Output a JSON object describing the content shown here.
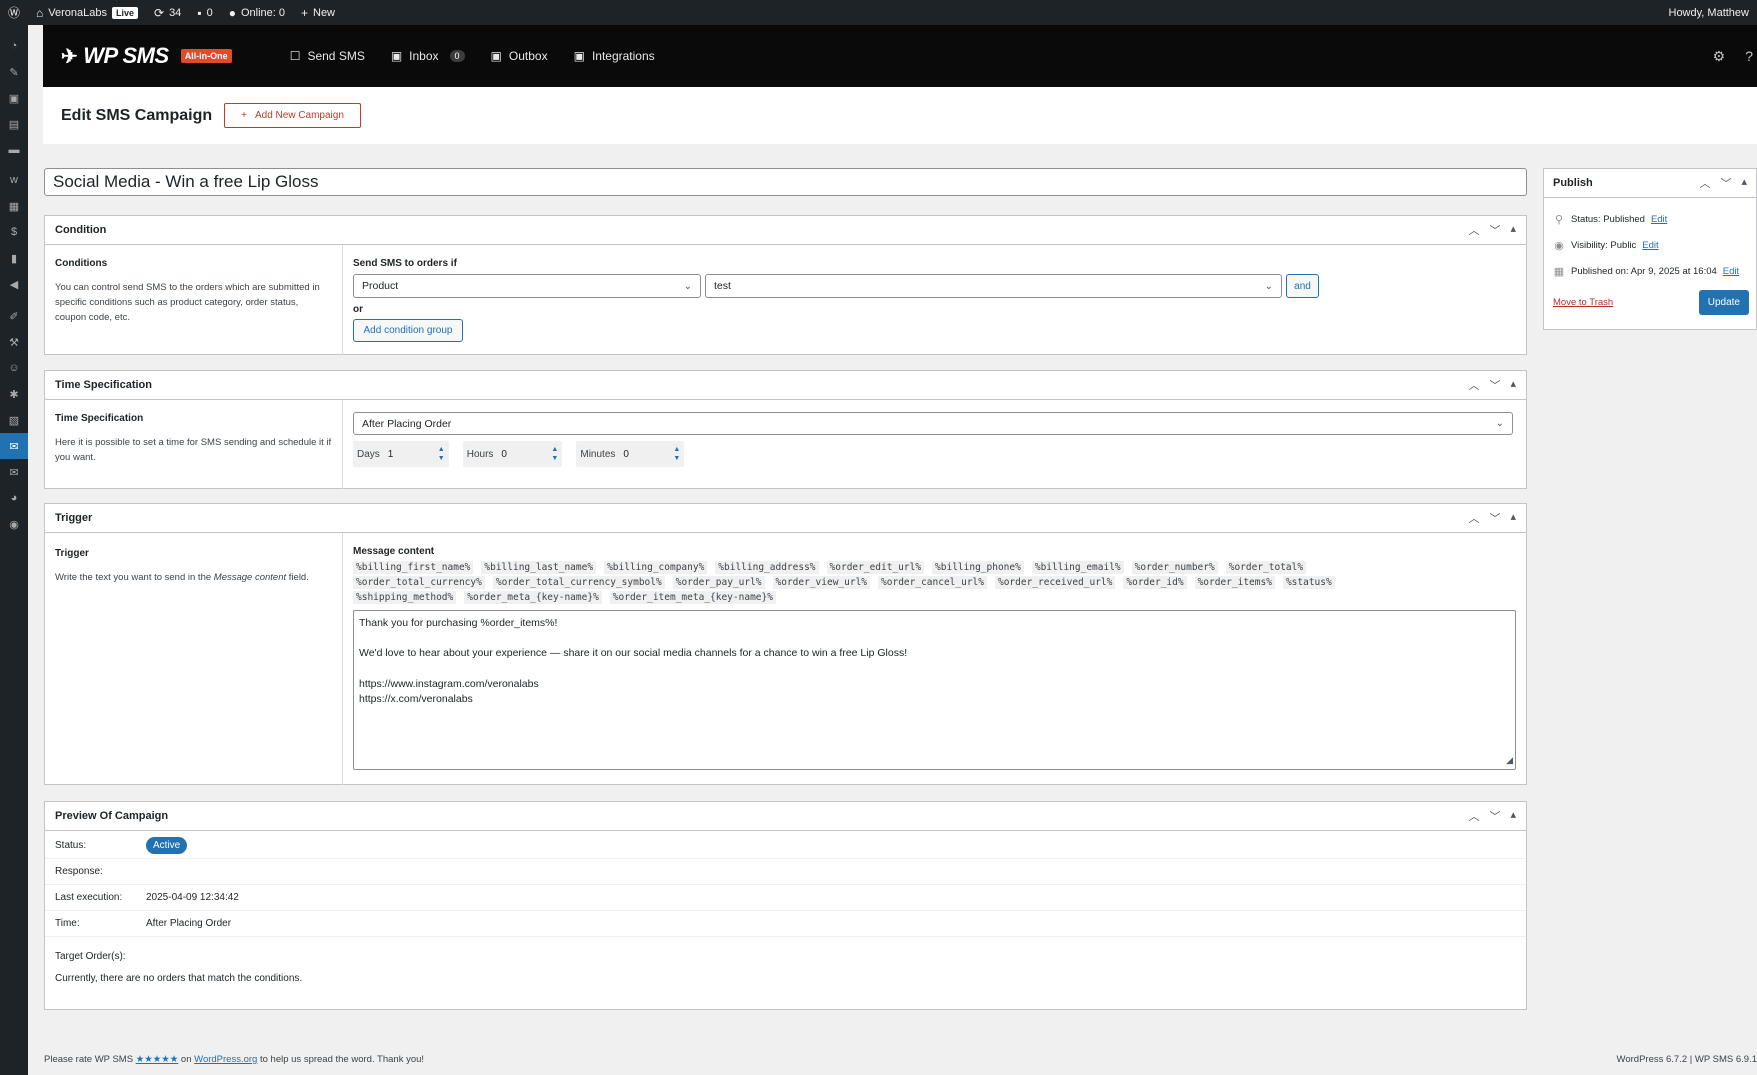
{
  "adminbar": {
    "site": "VeronaLabs",
    "live_badge": "Live",
    "updates": "34",
    "comments": "0",
    "online": "Online: 0",
    "new": "New",
    "howdy": "Howdy, Matthew"
  },
  "header": {
    "logo": "WP SMS",
    "badge": "All-in-One",
    "nav": {
      "send_sms": "Send SMS",
      "inbox": "Inbox",
      "inbox_count": "0",
      "outbox": "Outbox",
      "integrations": "Integrations"
    }
  },
  "page": {
    "title": "Edit SMS Campaign",
    "add_new": "Add New Campaign",
    "campaign_title": "Social Media - Win a free Lip Gloss"
  },
  "condition": {
    "box_title": "Condition",
    "left_title": "Conditions",
    "left_desc": "You can control send SMS to the orders which are submitted in specific conditions such as product category, order status, coupon code, etc.",
    "send_if_label": "Send SMS to orders if",
    "field_select": "Product",
    "value_select": "test",
    "and_button": "and",
    "or_label": "or",
    "add_group_button": "Add condition group"
  },
  "time_spec": {
    "box_title": "Time Specification",
    "left_title": "Time Specification",
    "left_desc": "Here it is possible to set a time for SMS sending and schedule it if you want.",
    "select": "After Placing Order",
    "days_label": "Days",
    "days_value": "1",
    "hours_label": "Hours",
    "hours_value": "0",
    "minutes_label": "Minutes",
    "minutes_value": "0"
  },
  "trigger": {
    "box_title": "Trigger",
    "left_title": "Trigger",
    "left_desc_a": "Write the text you want to send in the ",
    "left_desc_em": "Message content",
    "left_desc_b": " field.",
    "message_label": "Message content",
    "tags": [
      "%billing_first_name%",
      "%billing_last_name%",
      "%billing_company%",
      "%billing_address%",
      "%order_edit_url%",
      "%billing_phone%",
      "%billing_email%",
      "%order_number%",
      "%order_total%",
      "%order_total_currency%",
      "%order_total_currency_symbol%",
      "%order_pay_url%",
      "%order_view_url%",
      "%order_cancel_url%",
      "%order_received_url%",
      "%order_id%",
      "%order_items%",
      "%status%",
      "%shipping_method%",
      "%order_meta_{key-name}%",
      "%order_item_meta_{key-name}%"
    ],
    "message_lines": {
      "l1": "Thank you for purchasing %order_items%!",
      "l2": "We'd love to hear about your experience — share it on our social media channels for a chance to win a free Lip Gloss!",
      "l3": "https://www.instagram.com/veronalabs",
      "l4": "https://x.com/veronalabs"
    }
  },
  "preview": {
    "box_title": "Preview Of Campaign",
    "status_label": "Status:",
    "status_value": "Active",
    "response_label": "Response:",
    "last_exec_label": "Last execution:",
    "last_exec_value": "2025-04-09 12:34:42",
    "time_label": "Time:",
    "time_value": "After Placing Order",
    "target_label": "Target Order(s):",
    "target_note": "Currently, there are no orders that match the conditions."
  },
  "publish": {
    "title": "Publish",
    "status_text": "Status: Published",
    "visibility_text": "Visibility: Public",
    "published_text": "Published on: Apr 9, 2025 at 16:04",
    "edit": "Edit",
    "trash": "Move to Trash",
    "update": "Update"
  },
  "footer": {
    "rate_a": "Please rate WP SMS ",
    "stars": "★★★★★",
    "rate_on": " on ",
    "wporg": "WordPress.org",
    "rate_b": " to help us spread the word. Thank you!",
    "version": "WordPress 6.7.2 | WP SMS 6.9.1"
  },
  "colors": {
    "primary": "#2271b1",
    "danger": "#b32d2e",
    "header_bg": "#0a0a0a",
    "adminbar_bg": "#1d2327",
    "badge_red": "#e24a2c"
  }
}
